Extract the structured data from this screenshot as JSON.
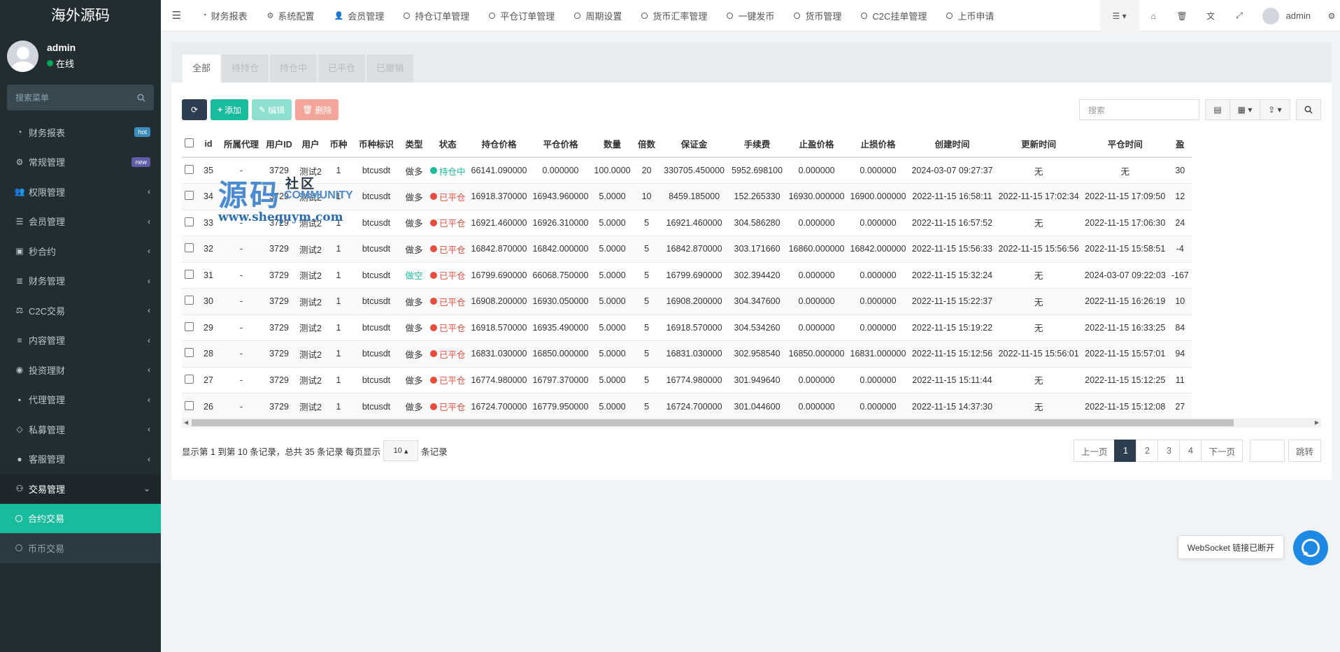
{
  "sidebar": {
    "logo": "海外源码",
    "user": {
      "name": "admin",
      "status": "在线"
    },
    "search_placeholder": "搜索菜单",
    "items": [
      {
        "label": "财务报表",
        "icon": "dashboard-icon",
        "badge": "hot"
      },
      {
        "label": "常规管理",
        "icon": "cogs-icon",
        "badge": "new"
      },
      {
        "label": "权限管理",
        "icon": "group-icon"
      },
      {
        "label": "会员管理",
        "icon": "list-icon"
      },
      {
        "label": "秒合约",
        "icon": "calendar-icon"
      },
      {
        "label": "财务管理",
        "icon": "database-icon"
      },
      {
        "label": "C2C交易",
        "icon": "balance-icon"
      },
      {
        "label": "内容管理",
        "icon": "align-icon"
      },
      {
        "label": "投资理财",
        "icon": "compass-icon"
      },
      {
        "label": "代理管理",
        "icon": "briefcase-icon"
      },
      {
        "label": "私募管理",
        "icon": "diamond-icon"
      },
      {
        "label": "客服管理",
        "icon": "comment-icon"
      }
    ],
    "open_menu": {
      "label": "交易管理",
      "icon": "handshake-icon"
    },
    "sub_items": [
      {
        "label": "合约交易",
        "active": true
      },
      {
        "label": "币币交易",
        "active": false
      }
    ]
  },
  "topnav": {
    "items": [
      {
        "label": "财务报表",
        "icon": "dashboard-icon"
      },
      {
        "label": "系统配置",
        "icon": "cog-icon"
      },
      {
        "label": "会员管理",
        "icon": "user-icon"
      },
      {
        "label": "持仓订单管理",
        "icon": "circle-icon"
      },
      {
        "label": "平仓订单管理",
        "icon": "circle-icon"
      },
      {
        "label": "周期设置",
        "icon": "circle-icon"
      },
      {
        "label": "货币汇率管理",
        "icon": "circle-icon"
      },
      {
        "label": "一键发币",
        "icon": "circle-icon"
      },
      {
        "label": "货币管理",
        "icon": "circle-icon"
      },
      {
        "label": "C2C挂单管理",
        "icon": "circle-icon"
      },
      {
        "label": "上币申请",
        "icon": "circle-icon"
      }
    ],
    "admin": "admin"
  },
  "tabs": [
    "全部",
    "待持仓",
    "持仓中",
    "已平仓",
    "已撤销"
  ],
  "toolbar": {
    "add": "添加",
    "edit": "编辑",
    "delete": "删除",
    "search_placeholder": "搜索"
  },
  "table": {
    "headers": [
      "id",
      "所属代理",
      "用户ID",
      "用户",
      "币种",
      "币种标识",
      "类型",
      "状态",
      "持仓价格",
      "平仓价格",
      "数量",
      "倍数",
      "保证金",
      "手续费",
      "止盈价格",
      "止损价格",
      "创建时间",
      "更新时间",
      "平仓时间",
      "盈"
    ],
    "rows": [
      [
        "35",
        "-",
        "3729",
        "测试2",
        "1",
        "btcusdt",
        "做多",
        "持仓中",
        "66141.090000",
        "0.000000",
        "100.0000",
        "20",
        "330705.450000",
        "5952.698100",
        "0.000000",
        "0.000000",
        "2024-03-07 09:27:37",
        "无",
        "无",
        "30"
      ],
      [
        "34",
        "-",
        "3729",
        "测试2",
        "1",
        "btcusdt",
        "做多",
        "已平仓",
        "16918.370000",
        "16943.960000",
        "5.0000",
        "10",
        "8459.185000",
        "152.265330",
        "16930.000000",
        "16900.000000",
        "2022-11-15 16:58:11",
        "2022-11-15 17:02:34",
        "2022-11-15 17:09:50",
        "12"
      ],
      [
        "33",
        "-",
        "3729",
        "测试2",
        "1",
        "btcusdt",
        "做多",
        "已平仓",
        "16921.460000",
        "16926.310000",
        "5.0000",
        "5",
        "16921.460000",
        "304.586280",
        "0.000000",
        "0.000000",
        "2022-11-15 16:57:52",
        "无",
        "2022-11-15 17:06:30",
        "24"
      ],
      [
        "32",
        "-",
        "3729",
        "测试2",
        "1",
        "btcusdt",
        "做多",
        "已平仓",
        "16842.870000",
        "16842.000000",
        "5.0000",
        "5",
        "16842.870000",
        "303.171660",
        "16860.000000",
        "16842.000000",
        "2022-11-15 15:56:33",
        "2022-11-15 15:56:56",
        "2022-11-15 15:58:51",
        "-4"
      ],
      [
        "31",
        "-",
        "3729",
        "测试2",
        "1",
        "btcusdt",
        "做空",
        "已平仓",
        "16799.690000",
        "66068.750000",
        "5.0000",
        "5",
        "16799.690000",
        "302.394420",
        "0.000000",
        "0.000000",
        "2022-11-15 15:32:24",
        "无",
        "2024-03-07 09:22:03",
        "-167"
      ],
      [
        "30",
        "-",
        "3729",
        "测试2",
        "1",
        "btcusdt",
        "做多",
        "已平仓",
        "16908.200000",
        "16930.050000",
        "5.0000",
        "5",
        "16908.200000",
        "304.347600",
        "0.000000",
        "0.000000",
        "2022-11-15 15:22:37",
        "无",
        "2022-11-15 16:26:19",
        "10"
      ],
      [
        "29",
        "-",
        "3729",
        "测试2",
        "1",
        "btcusdt",
        "做多",
        "已平仓",
        "16918.570000",
        "16935.490000",
        "5.0000",
        "5",
        "16918.570000",
        "304.534260",
        "0.000000",
        "0.000000",
        "2022-11-15 15:19:22",
        "无",
        "2022-11-15 16:33:25",
        "84"
      ],
      [
        "28",
        "-",
        "3729",
        "测试2",
        "1",
        "btcusdt",
        "做多",
        "已平仓",
        "16831.030000",
        "16850.000000",
        "5.0000",
        "5",
        "16831.030000",
        "302.958540",
        "16850.000000",
        "16831.000000",
        "2022-11-15 15:12:56",
        "2022-11-15 15:56:01",
        "2022-11-15 15:57:01",
        "94"
      ],
      [
        "27",
        "-",
        "3729",
        "测试2",
        "1",
        "btcusdt",
        "做多",
        "已平仓",
        "16774.980000",
        "16797.370000",
        "5.0000",
        "5",
        "16774.980000",
        "301.949640",
        "0.000000",
        "0.000000",
        "2022-11-15 15:11:44",
        "无",
        "2022-11-15 15:12:25",
        "11"
      ],
      [
        "26",
        "-",
        "3729",
        "测试2",
        "1",
        "btcusdt",
        "做多",
        "已平仓",
        "16724.700000",
        "16779.950000",
        "5.0000",
        "5",
        "16724.700000",
        "301.044600",
        "0.000000",
        "0.000000",
        "2022-11-15 14:37:30",
        "无",
        "2022-11-15 15:12:08",
        "27"
      ]
    ]
  },
  "footer": {
    "summary": "显示第 1 到第 10 条记录，总共 35 条记录 每页显示",
    "page_size": "10",
    "unit": "条记录",
    "prev": "上一页",
    "pages": [
      "1",
      "2",
      "3",
      "4"
    ],
    "next": "下一页",
    "go": "跳转"
  },
  "watermark": {
    "big": "源码",
    "side": "社区",
    "community": "COMMUNITY",
    "url": "www.shequym.com"
  },
  "websocket_tip": "WebSocket 链接已断开",
  "colors": {
    "sidebar_bg": "#222d32",
    "accent": "#18bc9c",
    "status_open": "#18bc9c",
    "status_closed": "#e74c3c",
    "type_short": "#18bc9c"
  }
}
